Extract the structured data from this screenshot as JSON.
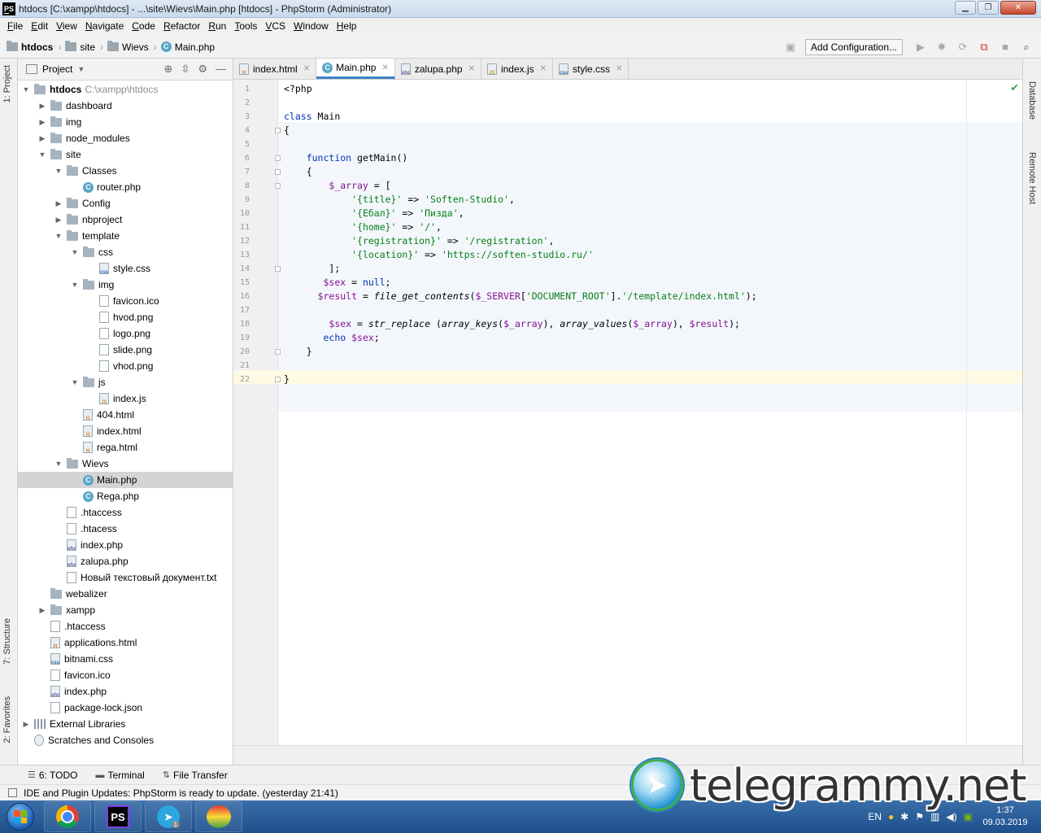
{
  "window": {
    "title": "htdocs [C:\\xampp\\htdocs] - ...\\site\\Wievs\\Main.php [htdocs] - PhpStorm (Administrator)",
    "app_icon": "PS",
    "controls": [
      "minimize",
      "maximize",
      "close"
    ]
  },
  "menu": [
    {
      "u": "F",
      "rest": "ile"
    },
    {
      "u": "E",
      "rest": "dit"
    },
    {
      "u": "V",
      "rest": "iew"
    },
    {
      "u": "N",
      "rest": "avigate"
    },
    {
      "u": "C",
      "rest": "ode"
    },
    {
      "u": "R",
      "rest": "efactor"
    },
    {
      "u": "R",
      "rest": "un"
    },
    {
      "u": "T",
      "rest": "ools"
    },
    {
      "u": "V",
      "rest": "CS"
    },
    {
      "u": "W",
      "rest": "indow"
    },
    {
      "u": "H",
      "rest": "elp"
    }
  ],
  "breadcrumb": [
    "htdocs",
    "site",
    "Wievs",
    "Main.php"
  ],
  "toolbar": {
    "add_config": "Add Configuration..."
  },
  "left_strip": {
    "project": "1: Project",
    "structure": "7: Structure",
    "favorites": "2: Favorites"
  },
  "right_strip": {
    "database": "Database",
    "remote_host": "Remote Host"
  },
  "project_panel": {
    "title": "Project",
    "tree": [
      {
        "level": 0,
        "arrow": "open",
        "icon": "folder",
        "label": "htdocs",
        "bold": true,
        "hint": "C:\\xampp\\htdocs"
      },
      {
        "level": 1,
        "arrow": "closed",
        "icon": "folder",
        "label": "dashboard"
      },
      {
        "level": 1,
        "arrow": "closed",
        "icon": "folder",
        "label": "img"
      },
      {
        "level": 1,
        "arrow": "closed",
        "icon": "folder",
        "label": "node_modules"
      },
      {
        "level": 1,
        "arrow": "open",
        "icon": "folder",
        "label": "site"
      },
      {
        "level": 2,
        "arrow": "open",
        "icon": "folder",
        "label": "Classes"
      },
      {
        "level": 3,
        "arrow": "none",
        "icon": "class",
        "label": "router.php"
      },
      {
        "level": 2,
        "arrow": "closed",
        "icon": "folder",
        "label": "Config"
      },
      {
        "level": 2,
        "arrow": "closed",
        "icon": "folder",
        "label": "nbproject"
      },
      {
        "level": 2,
        "arrow": "open",
        "icon": "folder",
        "label": "template"
      },
      {
        "level": 3,
        "arrow": "open",
        "icon": "folder",
        "label": "css"
      },
      {
        "level": 4,
        "arrow": "none",
        "icon": "css",
        "label": "style.css"
      },
      {
        "level": 3,
        "arrow": "open",
        "icon": "folder",
        "label": "img"
      },
      {
        "level": 4,
        "arrow": "none",
        "icon": "ico",
        "label": "favicon.ico"
      },
      {
        "level": 4,
        "arrow": "none",
        "icon": "png",
        "label": "hvod.png"
      },
      {
        "level": 4,
        "arrow": "none",
        "icon": "png",
        "label": "logo.png"
      },
      {
        "level": 4,
        "arrow": "none",
        "icon": "png",
        "label": "slide.png"
      },
      {
        "level": 4,
        "arrow": "none",
        "icon": "png",
        "label": "vhod.png"
      },
      {
        "level": 3,
        "arrow": "open",
        "icon": "folder",
        "label": "js"
      },
      {
        "level": 4,
        "arrow": "none",
        "icon": "js",
        "label": "index.js"
      },
      {
        "level": 3,
        "arrow": "none",
        "icon": "html",
        "label": "404.html"
      },
      {
        "level": 3,
        "arrow": "none",
        "icon": "html",
        "label": "index.html"
      },
      {
        "level": 3,
        "arrow": "none",
        "icon": "html",
        "label": "rega.html"
      },
      {
        "level": 2,
        "arrow": "open",
        "icon": "folder",
        "label": "Wievs"
      },
      {
        "level": 3,
        "arrow": "none",
        "icon": "class",
        "label": "Main.php",
        "selected": true
      },
      {
        "level": 3,
        "arrow": "none",
        "icon": "class",
        "label": "Rega.php"
      },
      {
        "level": 2,
        "arrow": "none",
        "icon": "txt",
        "label": ".htaccess"
      },
      {
        "level": 2,
        "arrow": "none",
        "icon": "txt",
        "label": ".htacess"
      },
      {
        "level": 2,
        "arrow": "none",
        "icon": "php",
        "label": "index.php"
      },
      {
        "level": 2,
        "arrow": "none",
        "icon": "php",
        "label": "zalupa.php"
      },
      {
        "level": 2,
        "arrow": "none",
        "icon": "txt",
        "label": "Новый текстовый документ.txt"
      },
      {
        "level": 1,
        "arrow": "none",
        "icon": "folder",
        "label": "webalizer"
      },
      {
        "level": 1,
        "arrow": "closed",
        "icon": "folder",
        "label": "xampp"
      },
      {
        "level": 1,
        "arrow": "none",
        "icon": "txt",
        "label": ".htaccess"
      },
      {
        "level": 1,
        "arrow": "none",
        "icon": "html",
        "label": "applications.html"
      },
      {
        "level": 1,
        "arrow": "none",
        "icon": "css",
        "label": "bitnami.css"
      },
      {
        "level": 1,
        "arrow": "none",
        "icon": "ico",
        "label": "favicon.ico"
      },
      {
        "level": 1,
        "arrow": "none",
        "icon": "php",
        "label": "index.php"
      },
      {
        "level": 1,
        "arrow": "none",
        "icon": "txt",
        "label": "package-lock.json"
      },
      {
        "level": 0,
        "arrow": "closed",
        "icon": "lib",
        "label": "External Libraries"
      },
      {
        "level": 0,
        "arrow": "none",
        "icon": "scratch",
        "label": "Scratches and Consoles"
      }
    ]
  },
  "tabs": [
    {
      "label": "index.html",
      "icon": "html"
    },
    {
      "label": "Main.php",
      "icon": "class",
      "active": true
    },
    {
      "label": "zalupa.php",
      "icon": "php"
    },
    {
      "label": "index.js",
      "icon": "js"
    },
    {
      "label": "style.css",
      "icon": "css"
    }
  ],
  "code_lines": [
    "<?php",
    "",
    "class Main",
    "{",
    "",
    "    function getMain()",
    "    {",
    "        $_array = [",
    "            '{title}' => 'Soften-Studio',",
    "            '{Ебал}' => 'Пизда',",
    "            '{home}' => '/',",
    "            '{registration}' => '/registration',",
    "            '{location}' => 'https://soften-studio.ru/'",
    "        ];",
    "       $sex = null;",
    "      $result = file_get_contents($_SERVER['DOCUMENT_ROOT'].'/template/index.html');",
    "",
    "        $sex = str_replace (array_keys($_array), array_values($_array), $result);",
    "       echo $sex;",
    "    }",
    "",
    "}"
  ],
  "bottom_tools": [
    {
      "icon": "todo-icon",
      "label": "6: TODO"
    },
    {
      "icon": "terminal-icon",
      "label": "Terminal"
    },
    {
      "icon": "file-transfer-icon",
      "label": "File Transfer"
    }
  ],
  "status": "IDE and Plugin Updates: PhpStorm is ready to update. (yesterday 21:41)",
  "taskbar": {
    "lang": "EN",
    "time": "1:37",
    "date": "09.03.2019",
    "telegram_badge": "1"
  },
  "watermark": "telegrammy.net"
}
